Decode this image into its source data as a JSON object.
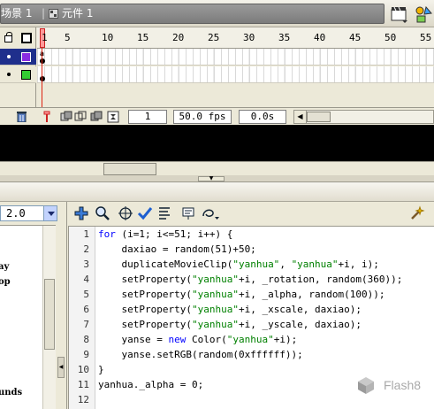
{
  "breadcrumb": {
    "scene": "场景 1",
    "separator": "|",
    "symbol": "元件 1"
  },
  "toolbar_icons": [
    "edit-scene-icon",
    "edit-symbol-icon"
  ],
  "timeline": {
    "header_icons": [
      "eye-icon",
      "lock-icon",
      "outline-icon"
    ],
    "frame_numbers": [
      "1",
      "5",
      "10",
      "15",
      "20",
      "25",
      "30",
      "35",
      "40",
      "45",
      "50",
      "55"
    ],
    "layers": [
      {
        "row": 1,
        "selected": true,
        "swatch_color": "#8a2be2"
      },
      {
        "row": 2,
        "selected": false,
        "swatch_color": "#33cc33"
      }
    ],
    "current_frame": "1",
    "frame_rate": "50.0 fps",
    "elapsed_time": "0.0s"
  },
  "actions": {
    "version": "2.0",
    "tree_items": [
      "ay",
      "op",
      "unds"
    ],
    "code_lines": [
      "for (i=1; i<=51; i++) {",
      "    daxiao = random(51)+50;",
      "    duplicateMovieClip(\"yanhua\", \"yanhua\"+i, i);",
      "    setProperty(\"yanhua\"+i, _rotation, random(360));",
      "    setProperty(\"yanhua\"+i, _alpha, random(100));",
      "    setProperty(\"yanhua\"+i, _xscale, daxiao);",
      "    setProperty(\"yanhua\"+i, _yscale, daxiao);",
      "    yanse = new Color(\"yanhua\"+i);",
      "    yanse.setRGB(random(0xffffff));",
      "}",
      "yanhua._alpha = 0;",
      ""
    ],
    "line_numbers": [
      "1",
      "2",
      "3",
      "4",
      "5",
      "6",
      "7",
      "8",
      "9",
      "10",
      "11",
      "12"
    ]
  },
  "logo": {
    "text": "Flash8"
  },
  "colors": {
    "stage": "#000000",
    "keyword": "#0000ff",
    "string": "#008000",
    "selected_layer": "#1f2f8c",
    "playhead": "#ff9a9a"
  }
}
